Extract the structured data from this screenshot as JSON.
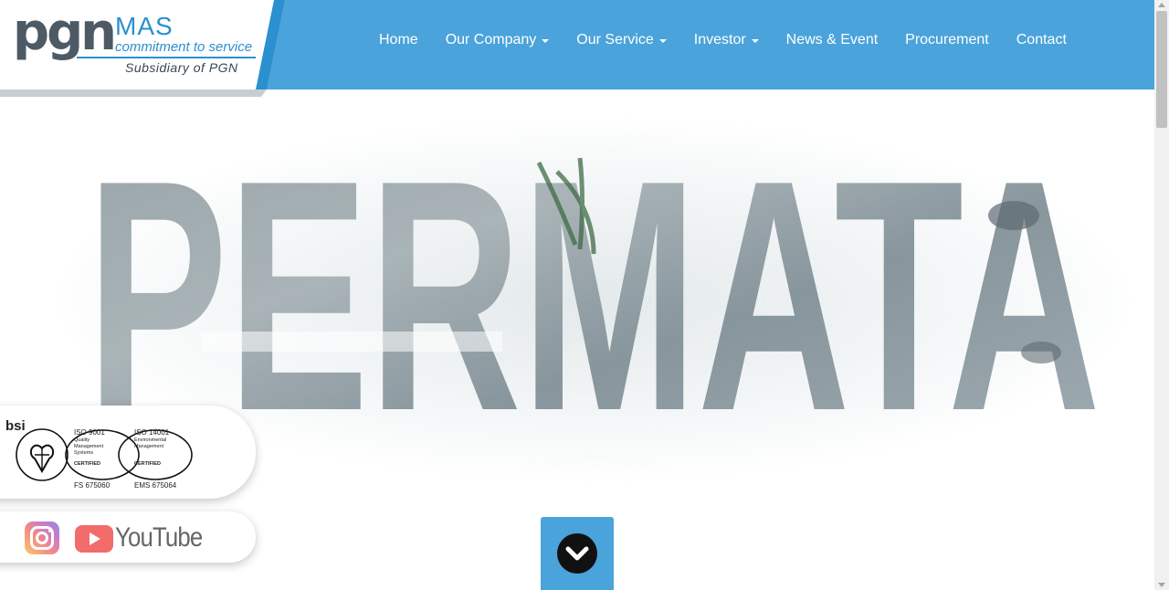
{
  "logo": {
    "wordmark": "pgn",
    "name": "MAS",
    "tagline": "commitment to service",
    "subsidiary": "Subsidiary of PGN"
  },
  "nav": {
    "items": [
      {
        "label": "Home",
        "dropdown": false
      },
      {
        "label": "Our Company",
        "dropdown": true
      },
      {
        "label": "Our Service",
        "dropdown": true
      },
      {
        "label": "Investor",
        "dropdown": true
      },
      {
        "label": "News & Event",
        "dropdown": false
      },
      {
        "label": "Procurement",
        "dropdown": false
      },
      {
        "label": "Contact",
        "dropdown": false
      }
    ]
  },
  "hero": {
    "word": "PERMATA"
  },
  "certification": {
    "issuer": "bsi",
    "iso9001": {
      "code": "ISO 9001",
      "desc1": "Quality",
      "desc2": "Management",
      "desc3": "Systems",
      "status": "CERTIFIED",
      "number": "FS 675060"
    },
    "iso14001": {
      "code": "ISO 14001",
      "desc1": "Environmental",
      "desc2": "Management",
      "status": "CERTIFIED",
      "number": "EMS 675064"
    }
  },
  "social": {
    "instagram_icon": "instagram-icon",
    "youtube_icon": "youtube-icon",
    "youtube_label": "YouTube"
  },
  "scroll_button": {
    "icon": "chevron-down-icon"
  },
  "colors": {
    "header_blue": "#4aa3db",
    "logo_blue": "#2a90d0",
    "logo_gray": "#4d5a66",
    "hero_text": "#7f8e96"
  }
}
